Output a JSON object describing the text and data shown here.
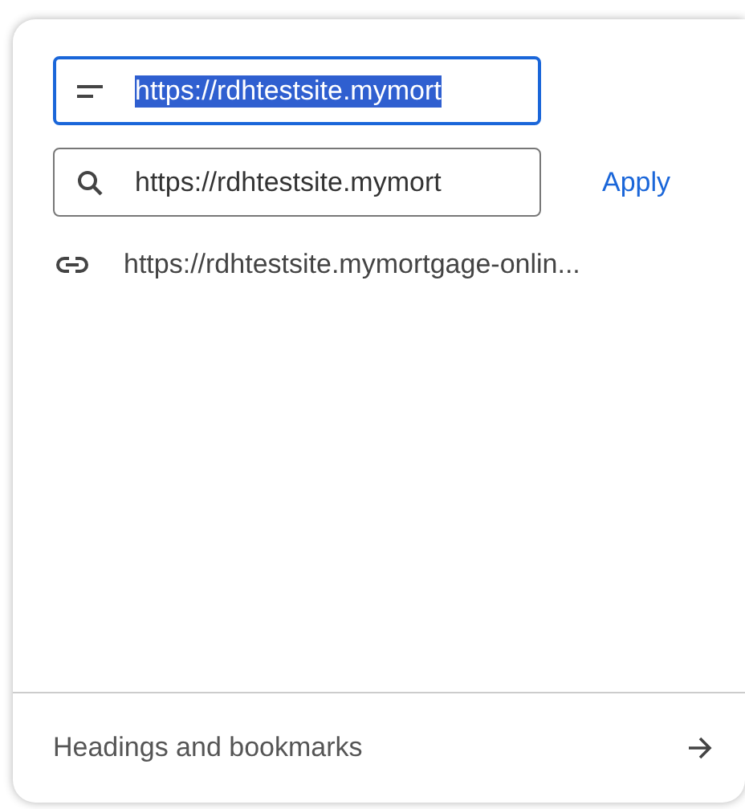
{
  "title_field": {
    "value": "https://rdhtestsite.mymort",
    "selected": true,
    "focused": true
  },
  "search_field": {
    "value": "https://rdhtestsite.mymort"
  },
  "apply_button": {
    "label": "Apply"
  },
  "results": [
    {
      "text": "https://rdhtestsite.mymortgage-onlin..."
    }
  ],
  "footer": {
    "label": "Headings and bookmarks"
  }
}
